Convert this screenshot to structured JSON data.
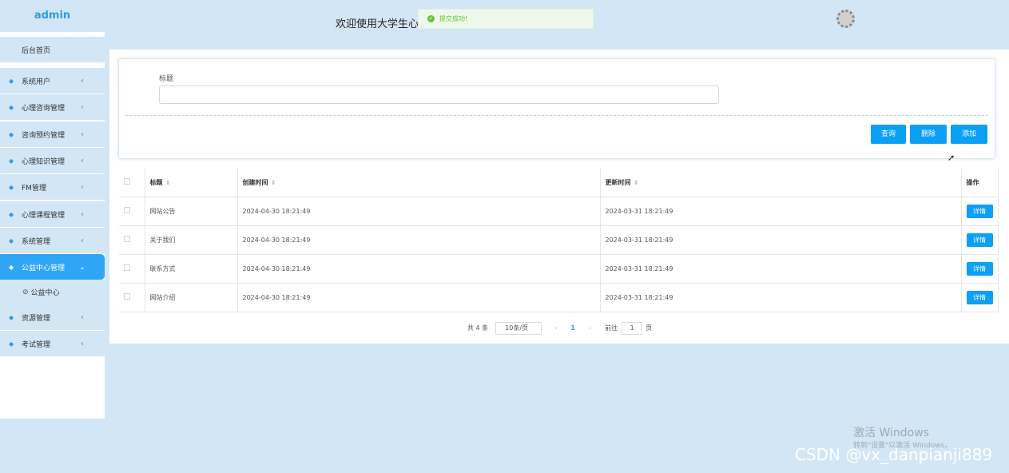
{
  "sidebar": {
    "logo": "admin",
    "home": "后台首页",
    "items": [
      {
        "label": "系统用户"
      },
      {
        "label": "心理咨询管理"
      },
      {
        "label": "咨询预约管理"
      },
      {
        "label": "心理知识管理"
      },
      {
        "label": "FM管理"
      },
      {
        "label": "心理课程管理"
      },
      {
        "label": "系统管理"
      },
      {
        "label": "公益中心管理"
      },
      {
        "label": "资源管理"
      },
      {
        "label": "考试管理"
      }
    ],
    "submenu": "公益中心"
  },
  "header": {
    "welcome": "欢迎使用大学生心",
    "toast": "提交成功!"
  },
  "search": {
    "label": "标题",
    "value": "",
    "query_label": "查询",
    "delete_label": "删除",
    "add_label": "添加"
  },
  "table": {
    "columns": [
      "标题",
      "创建时间",
      "更新时间",
      "操作"
    ],
    "rows": [
      {
        "title": "网站公告",
        "created": "2024-04-30 18:21:49",
        "updated": "2024-03-31 18:21:49",
        "action": "详情"
      },
      {
        "title": "关于我们",
        "created": "2024-04-30 18:21:49",
        "updated": "2024-03-31 18:21:49",
        "action": "详情"
      },
      {
        "title": "联系方式",
        "created": "2024-04-30 18:21:49",
        "updated": "2024-03-31 18:21:49",
        "action": "详情"
      },
      {
        "title": "网站介绍",
        "created": "2024-04-30 18:21:49",
        "updated": "2024-03-31 18:21:49",
        "action": "详情"
      }
    ]
  },
  "pagination": {
    "total": "共 4 条",
    "page_size": "10条/页",
    "prev": "‹",
    "current": "1",
    "next": "›",
    "goto": "前往",
    "jump_value": "1",
    "unit": "页"
  },
  "watermark": {
    "win_title": "激活 Windows",
    "win_sub": "转到\"设置\"以激活 Windows。",
    "csdn": "CSDN @vx_danpianji889"
  },
  "colors": {
    "accent": "#0aa0f5",
    "background": "#d3e6f5",
    "active_menu": "#2fa6f5"
  }
}
